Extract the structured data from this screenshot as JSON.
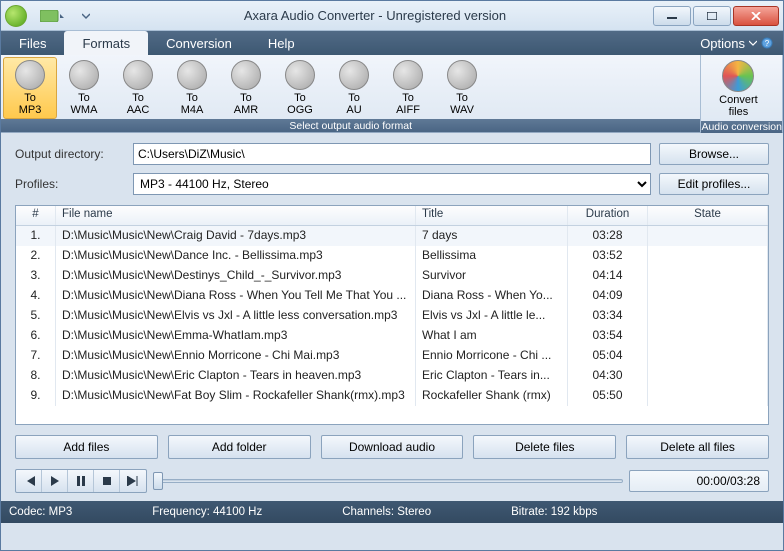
{
  "window": {
    "title": "Axara Audio Converter - Unregistered version",
    "options_label": "Options"
  },
  "menu": [
    "Files",
    "Formats",
    "Conversion",
    "Help"
  ],
  "menu_active_index": 1,
  "ribbon": {
    "formats": [
      {
        "label": "To\nMP3",
        "icon": "mp3"
      },
      {
        "label": "To\nWMA",
        "icon": "wma"
      },
      {
        "label": "To\nAAC",
        "icon": "aac"
      },
      {
        "label": "To\nM4A",
        "icon": "m4a"
      },
      {
        "label": "To\nAMR",
        "icon": "amr"
      },
      {
        "label": "To\nOGG",
        "icon": "ogg"
      },
      {
        "label": "To\nAU",
        "icon": "au"
      },
      {
        "label": "To\nAIFF",
        "icon": "aiff"
      },
      {
        "label": "To\nWAV",
        "icon": "wav"
      }
    ],
    "format_selected_index": 0,
    "group1_caption": "Select output audio format",
    "convert_label": "Convert\nfiles",
    "group2_caption": "Audio conversion"
  },
  "form": {
    "output_label": "Output directory:",
    "output_value": "C:\\Users\\DiZ\\Music\\",
    "browse": "Browse...",
    "profiles_label": "Profiles:",
    "profiles_value": "MP3 - 44100 Hz, Stereo",
    "edit_profiles": "Edit profiles..."
  },
  "columns": {
    "num": "#",
    "file": "File name",
    "title": "Title",
    "duration": "Duration",
    "state": "State"
  },
  "rows": [
    {
      "n": "1.",
      "file": "D:\\Music\\Music\\New\\Craig David - 7days.mp3",
      "title": "7 days",
      "dur": "03:28",
      "state": ""
    },
    {
      "n": "2.",
      "file": "D:\\Music\\Music\\New\\Dance Inc. - Bellissima.mp3",
      "title": "Bellissima",
      "dur": "03:52",
      "state": ""
    },
    {
      "n": "3.",
      "file": "D:\\Music\\Music\\New\\Destinys_Child_-_Survivor.mp3",
      "title": "Survivor",
      "dur": "04:14",
      "state": ""
    },
    {
      "n": "4.",
      "file": "D:\\Music\\Music\\New\\Diana Ross - When You Tell Me That You ...",
      "title": "Diana Ross - When Yo...",
      "dur": "04:09",
      "state": ""
    },
    {
      "n": "5.",
      "file": "D:\\Music\\Music\\New\\Elvis vs Jxl - A little less conversation.mp3",
      "title": "Elvis vs Jxl - A little le...",
      "dur": "03:34",
      "state": ""
    },
    {
      "n": "6.",
      "file": "D:\\Music\\Music\\New\\Emma-WhatIam.mp3",
      "title": "What I am",
      "dur": "03:54",
      "state": ""
    },
    {
      "n": "7.",
      "file": "D:\\Music\\Music\\New\\Ennio Morricone - Chi Mai.mp3",
      "title": "Ennio Morricone - Chi ...",
      "dur": "05:04",
      "state": ""
    },
    {
      "n": "8.",
      "file": "D:\\Music\\Music\\New\\Eric Clapton - Tears in heaven.mp3",
      "title": "Eric Clapton - Tears in...",
      "dur": "04:30",
      "state": ""
    },
    {
      "n": "9.",
      "file": "D:\\Music\\Music\\New\\Fat Boy Slim - Rockafeller Shank(rmx).mp3",
      "title": "Rockafeller Shank (rmx)",
      "dur": "05:50",
      "state": ""
    }
  ],
  "actions": {
    "add_files": "Add files",
    "add_folder": "Add folder",
    "download": "Download audio",
    "delete_files": "Delete files",
    "delete_all": "Delete all files"
  },
  "player": {
    "time": "00:00/03:28"
  },
  "status": {
    "codec": "Codec: MP3",
    "freq": "Frequency: 44100 Hz",
    "channels": "Channels: Stereo",
    "bitrate": "Bitrate: 192 kbps"
  }
}
